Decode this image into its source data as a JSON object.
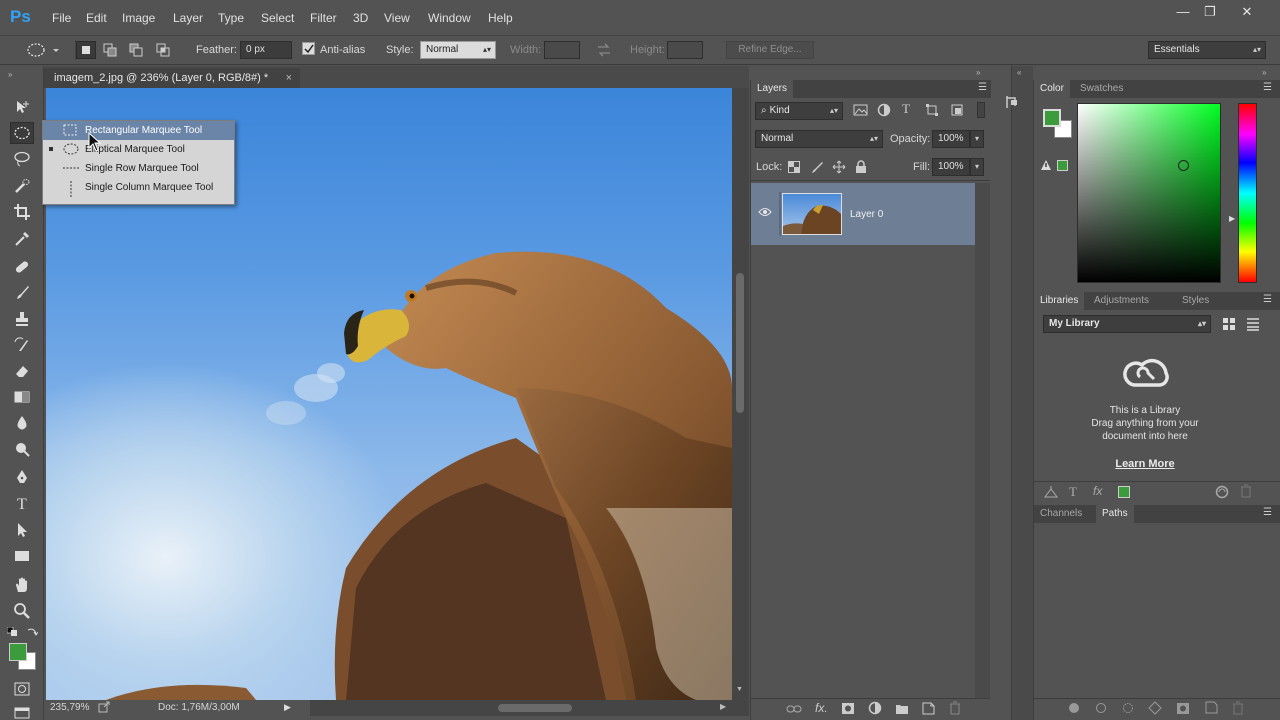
{
  "app": {
    "logo": "Ps"
  },
  "menu": [
    "File",
    "Edit",
    "Image",
    "Layer",
    "Type",
    "Select",
    "Filter",
    "3D",
    "View",
    "Window",
    "Help"
  ],
  "window_controls": {
    "minimize": "—",
    "restore": "❐",
    "close": "✕"
  },
  "options_bar": {
    "feather_label": "Feather:",
    "feather_value": "0 px",
    "antialias_label": "Anti-alias",
    "antialias_checked": true,
    "style_label": "Style:",
    "style_value": "Normal",
    "width_label": "Width:",
    "height_label": "Height:",
    "refine_edge": "Refine Edge...",
    "workspace": "Essentials"
  },
  "document": {
    "tab_title": "imagem_2.jpg @ 236% (Layer 0, RGB/8#) *",
    "close": "×",
    "zoom": "235,79%",
    "doc_size": "Doc: 1,76M/3,00M"
  },
  "marquee_flyout": {
    "items": [
      {
        "label": "Rectangular Marquee Tool",
        "icon": "rect-marquee-icon",
        "highlighted": true
      },
      {
        "label": "Elliptical Marquee Tool",
        "icon": "ellipse-marquee-icon",
        "current": true
      },
      {
        "label": "Single Row Marquee Tool",
        "icon": "single-row-icon"
      },
      {
        "label": "Single Column Marquee Tool",
        "icon": "single-column-icon"
      }
    ]
  },
  "layers_panel": {
    "tab": "Layers",
    "filter_kind": "Kind",
    "blend_mode": "Normal",
    "opacity_label": "Opacity:",
    "opacity_value": "100%",
    "lock_label": "Lock:",
    "fill_label": "Fill:",
    "fill_value": "100%",
    "layers": [
      {
        "name": "Layer 0",
        "visible": true,
        "selected": true
      }
    ]
  },
  "color_panel": {
    "tabs": [
      "Color",
      "Swatches"
    ],
    "foreground": "#3c9c3c",
    "background": "#ffffff",
    "out_of_gamut_swatch": "#3c9c3c"
  },
  "libraries_panel": {
    "tabs": [
      "Libraries",
      "Adjustments",
      "Styles"
    ],
    "library": "My Library",
    "message_line1": "This is a Library",
    "message_line2": "Drag anything from your",
    "message_line3": "document into here",
    "learn_more": "Learn More"
  },
  "paths_panel": {
    "tabs": [
      "Channels",
      "Paths"
    ]
  },
  "colors": {
    "accent": "#2fa3f6",
    "ui_bg": "#535353",
    "selected_layer": "#6d7e95",
    "highlight": "#6a85a8"
  }
}
